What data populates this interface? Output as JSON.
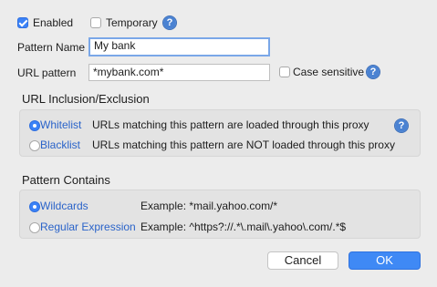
{
  "options": {
    "enabled_label": "Enabled",
    "enabled_checked": true,
    "temporary_label": "Temporary",
    "temporary_checked": false
  },
  "form": {
    "pattern_name_label": "Pattern Name",
    "pattern_name_value": "My bank",
    "url_pattern_label": "URL pattern",
    "url_pattern_value": "*mybank.com*",
    "case_sensitive_label": "Case sensitive",
    "case_sensitive_checked": false
  },
  "inclusion": {
    "title": "URL Inclusion/Exclusion",
    "whitelist_label": "Whitelist",
    "whitelist_desc": "URLs matching this pattern are loaded through this proxy",
    "blacklist_label": "Blacklist",
    "blacklist_desc": "URLs matching this pattern are NOT loaded through this proxy",
    "selected": "Whitelist"
  },
  "contains": {
    "title": "Pattern Contains",
    "wildcards_label": "Wildcards",
    "wildcards_example": "Example: *mail.yahoo.com/*",
    "regex_label": "Regular Expression",
    "regex_example": "Example: ^https?://.*\\.mail\\.yahoo\\.com/.*$",
    "selected": "Wildcards"
  },
  "buttons": {
    "cancel_label": "Cancel",
    "ok_label": "OK"
  },
  "colors": {
    "accent": "#3b82f7",
    "link": "#2a63c9",
    "background": "#ececec"
  },
  "icons": {
    "help": "?"
  }
}
